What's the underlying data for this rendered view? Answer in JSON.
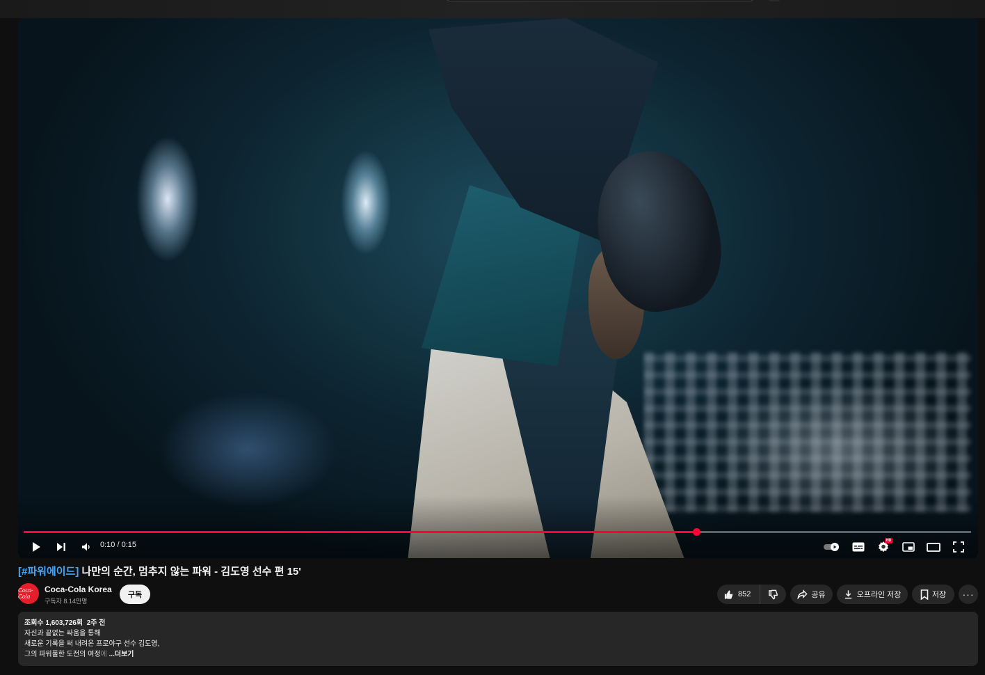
{
  "player": {
    "current_time": "0:10",
    "duration": "0:15",
    "time_display": "0:10 / 0:15",
    "progress": 0.71,
    "colors": {
      "progress": "#ff0033",
      "accent_link": "#3ea6ff"
    }
  },
  "video": {
    "title_hashtag": "[#파워에이드]",
    "title_rest": " 나만의 순간, 멈추지 않는 파워 - 김도영 선수 편 15'"
  },
  "channel": {
    "logo_text": "Coca-Cola",
    "name": "Coca-Cola Korea",
    "subscribers": "구독자 8.14만명",
    "subscribe_label": "구독"
  },
  "actions": {
    "like_count": "852",
    "share_label": "공유",
    "download_label": "오프라인 저장",
    "save_label": "저장",
    "more_label": "···"
  },
  "description": {
    "views": "조회수 1,603,726회",
    "age": "2주 전",
    "line1": "자신과 끝없는 싸움을 통해",
    "line2": "새로운 기록을 써 내려온 프로야구 선수 김도영,",
    "line3": "그의 파워풀한 도전의 여정",
    "line3_fade": "에",
    "more_label": "...더보기"
  },
  "icons": [
    "play-icon",
    "next-icon",
    "volume-icon",
    "autoplay-toggle-icon",
    "subtitles-icon",
    "settings-icon",
    "hd-badge-icon",
    "miniplayer-icon",
    "theater-icon",
    "fullscreen-icon",
    "like-icon",
    "dislike-icon",
    "share-icon",
    "download-icon",
    "bookmark-icon"
  ]
}
